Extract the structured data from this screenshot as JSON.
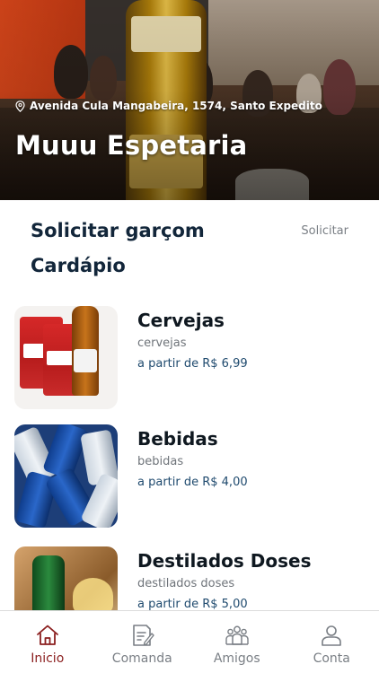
{
  "venue": {
    "address": "Avenida Cula Mangabeira, 1574, Santo Expedito",
    "name": "Muuu Espetaria"
  },
  "waiter": {
    "title": "Solicitar garçom",
    "action_label": "Solicitar"
  },
  "menu": {
    "title": "Cardápio",
    "categories": [
      {
        "name": "Cervejas",
        "subtitle": "cervejas",
        "price": "a partir de R$ 6,99",
        "image": "beer-pack-image"
      },
      {
        "name": "Bebidas",
        "subtitle": "bebidas",
        "price": "a partir de R$ 4,00",
        "image": "beer-cans-image"
      },
      {
        "name": "Destilados Doses",
        "subtitle": "destilados doses",
        "price": "a partir de R$ 5,00",
        "image": "spirits-image"
      }
    ]
  },
  "bottom_nav": {
    "items": [
      {
        "label": "Inicio",
        "icon": "home-icon",
        "active": true
      },
      {
        "label": "Comanda",
        "icon": "order-pad-icon",
        "active": false
      },
      {
        "label": "Amigos",
        "icon": "friends-icon",
        "active": false
      },
      {
        "label": "Conta",
        "icon": "user-icon",
        "active": false
      }
    ],
    "active_color": "#8b1f1f",
    "inactive_color": "#7a7f85"
  }
}
